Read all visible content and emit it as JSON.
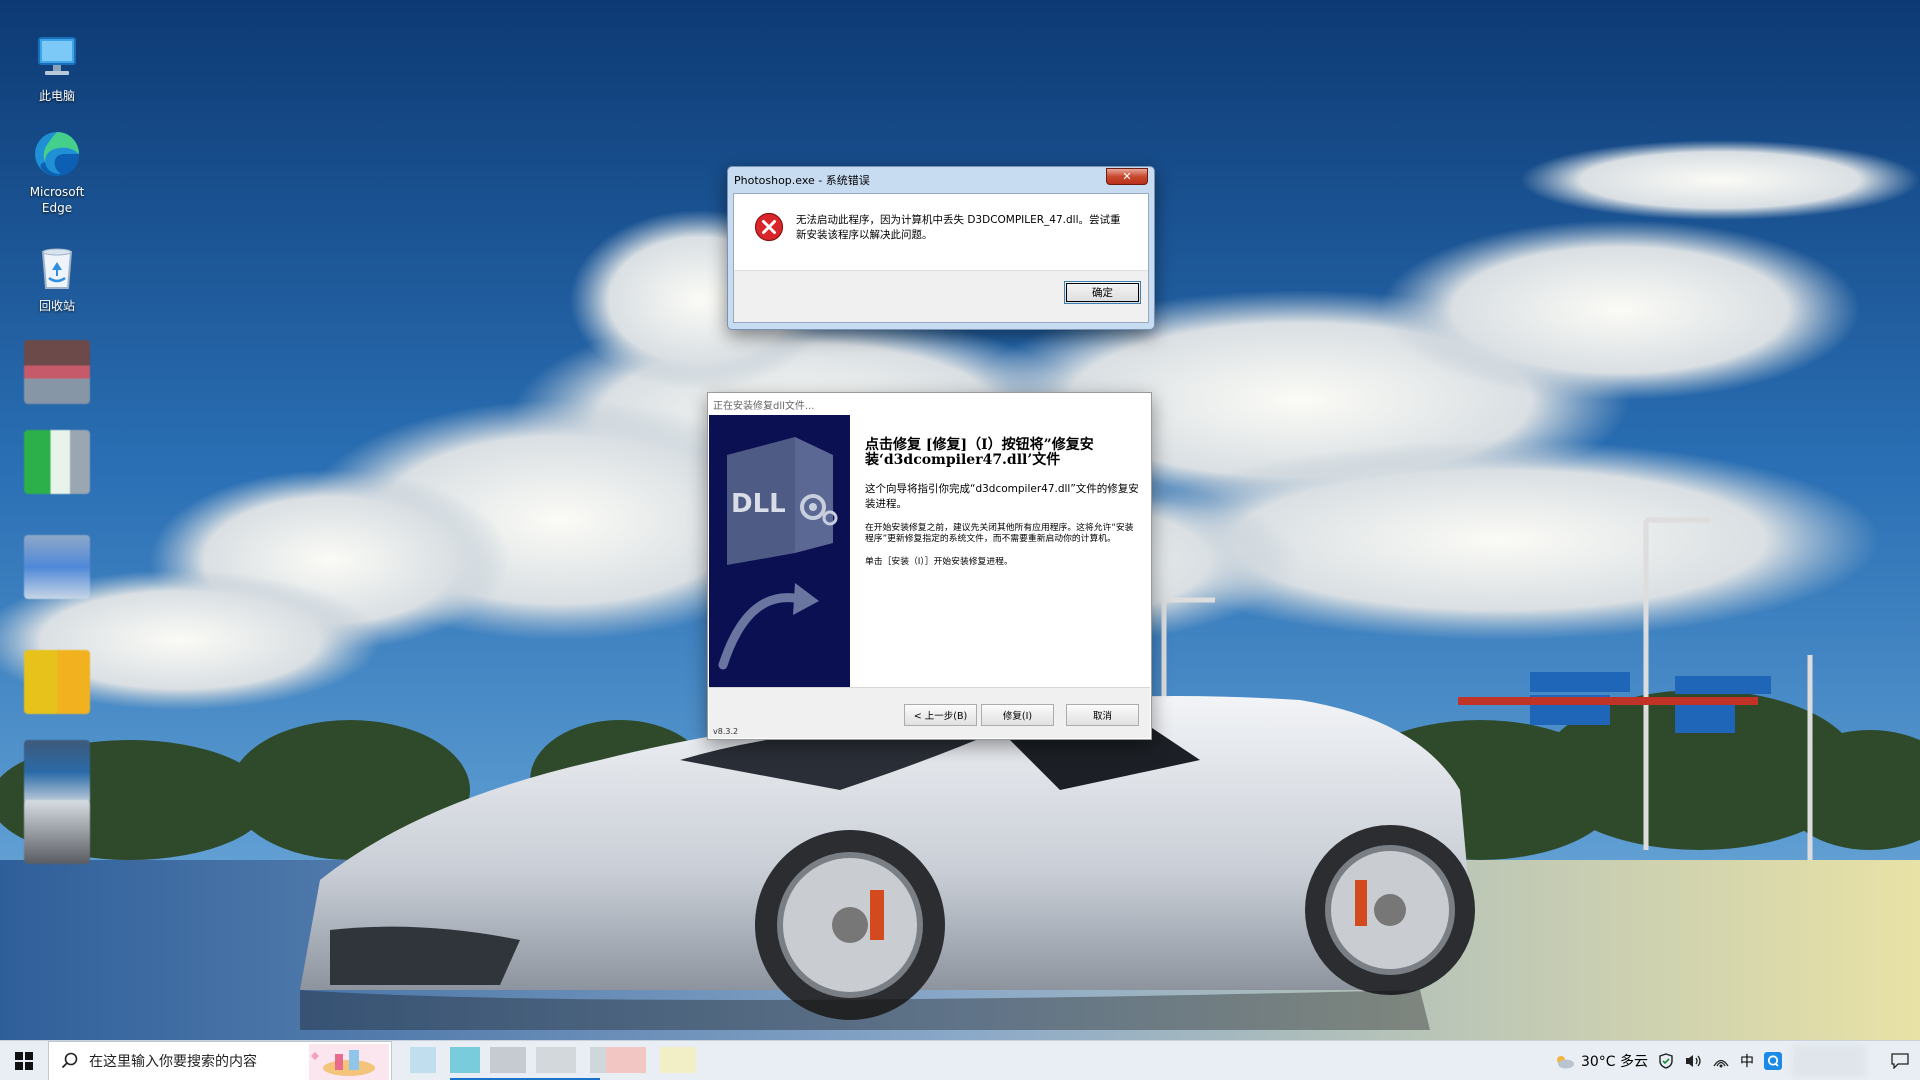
{
  "desktop": {
    "icons": [
      {
        "label": "此电脑",
        "icon": "computer-icon"
      },
      {
        "label": "Microsoft\nEdge",
        "icon": "edge-icon"
      },
      {
        "label": "回收站",
        "icon": "recycle-bin-icon"
      }
    ]
  },
  "error_dialog": {
    "title": "Photoshop.exe - 系统错误",
    "close_label": "✕",
    "message": "无法启动此程序，因为计算机中丢失 D3DCOMPILER_47.dll。尝试重新安装该程序以解决此问题。",
    "ok_label": "确定",
    "icon": "error-icon",
    "colors": {
      "error_red": "#d8262a"
    }
  },
  "installer_dialog": {
    "title": "正在安装修复dll文件...",
    "side_text": "DLL",
    "heading": "点击修复 [修复]（I）按钮将”修复安装‘d3dcompiler47.dll’文件",
    "paragraph1": "这个向导将指引你完成“d3dcompiler47.dll”文件的修复安装进程。",
    "paragraph2": "在开始安装修复之前，建议先关闭其他所有应用程序。这将允许“安装程序”更新修复指定的系统文件，而不需要重新启动你的计算机。",
    "paragraph3": "单击［安装（I）］开始安装修复进程。",
    "version": "v8.3.2",
    "buttons": {
      "back": "< 上一步(B)",
      "repair": "修复(I)",
      "cancel": "取消"
    },
    "colors": {
      "side_panel": "#0b1052"
    }
  },
  "taskbar": {
    "search_placeholder": "在这里输入你要搜索的内容",
    "weather": "30°C  多云",
    "tray_icons": [
      "weather-icon",
      "security-icon",
      "volume-icon",
      "network-icon",
      "ime-icon",
      "app-q-icon"
    ],
    "ime_label": "中"
  }
}
